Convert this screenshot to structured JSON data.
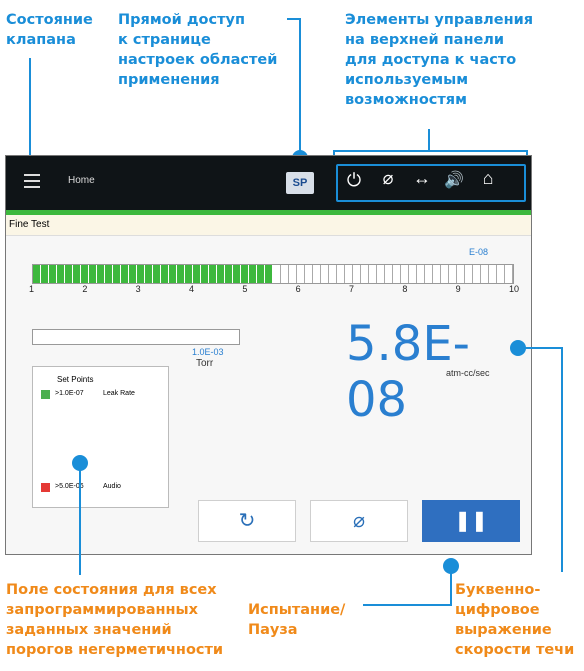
{
  "annotations": {
    "valve_state": "Состояние\nклапана",
    "direct_access": "Прямой доступ\nк странице\nнастроек областей\nприменения",
    "top_panel": "Элементы управления\nна верхней панели\nдля доступа к часто\nиспользуемым\nвозможностям",
    "setpoints_field": "Поле состояния для всех\nзапрограммированных\nзаданных значений\nпорогов негерметичности",
    "test_pause": "Испытание/\nПауза",
    "leak_rate_expression": "Буквенно-\nцифровое\nвыражение\nскорости течи"
  },
  "screen": {
    "topbar": {
      "menu_icon": "menu-icon",
      "title": "Home",
      "sp_label": "SP",
      "icons": [
        "power-icon",
        "zero-icon",
        "arrows-icon",
        "speaker-icon",
        "home-icon"
      ]
    },
    "mode": "Fine Test",
    "bar": {
      "exponent_label": "E-08",
      "filled_fraction": 0.5,
      "tick_labels": [
        "1",
        "2",
        "3",
        "4",
        "5",
        "6",
        "7",
        "8",
        "9",
        "10"
      ]
    },
    "pressure": {
      "value": "1.0E-03",
      "unit": "Torr"
    },
    "leak": {
      "value": "5.8E-08",
      "unit": "atm-cc/sec"
    },
    "setpoints": {
      "title": "Set Points",
      "items": [
        {
          "value": ">1.0E-07",
          "label": "Leak Rate",
          "color": "#4caf50"
        },
        {
          "value": ">5.0E-06",
          "label": "Audio",
          "color": "#e53935"
        }
      ]
    },
    "controls": {
      "zero_icon": "zero-icon",
      "refresh_icon": "refresh-icon",
      "pause_icon": "pause-icon",
      "accent": "#2f6fc0"
    }
  }
}
